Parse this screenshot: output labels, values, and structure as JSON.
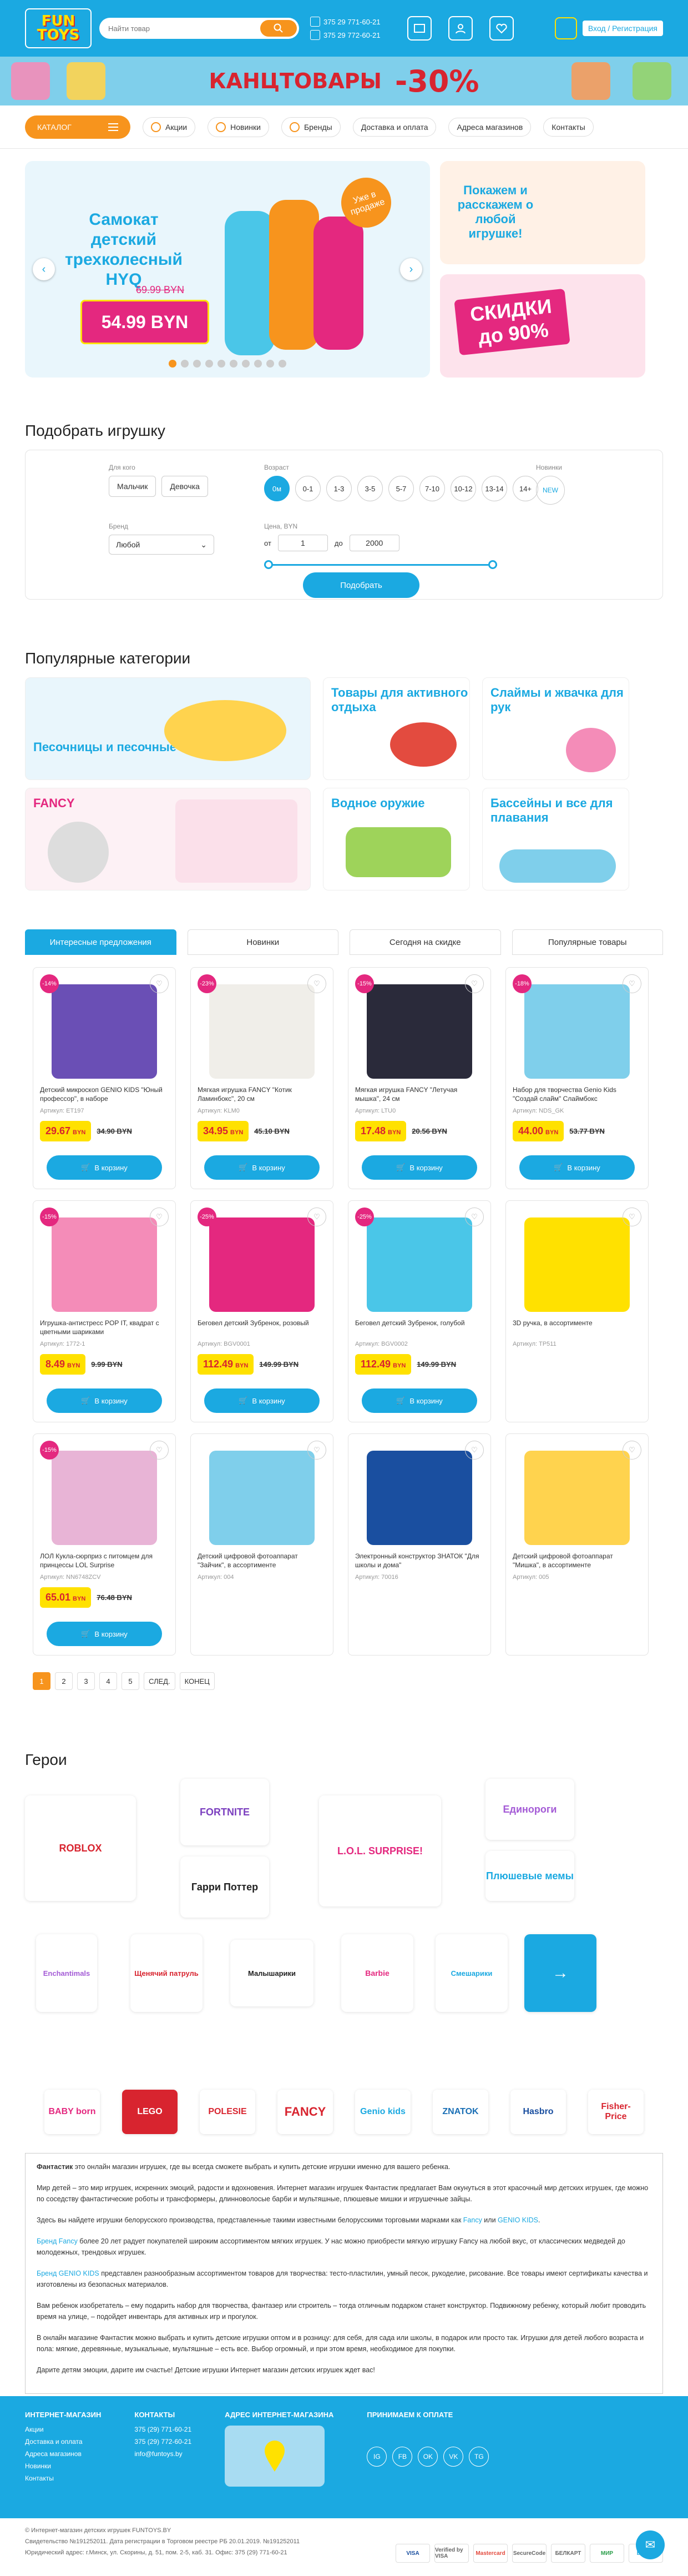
{
  "header": {
    "logo_text": "FUN TOYS",
    "search_placeholder": "Найти товар",
    "phone1": "375 29 771-60-21",
    "phone2": "375 29 772-60-21",
    "login_label": "Вход / Регистрация",
    "accent": "#1ba9e1",
    "icons": [
      "map-icon",
      "user-icon",
      "heart-icon",
      "basket-icon"
    ]
  },
  "promo": {
    "title": "КАНЦТОВАРЫ",
    "discount": "-30%"
  },
  "nav": {
    "catalog": "КАТАЛОГ",
    "items": [
      "Акции",
      "Новинки",
      "Бренды",
      "Доставка и оплата",
      "Адреса магазинов",
      "Контакты"
    ]
  },
  "slider": {
    "title": "Самокат детский трехколесный HYQ",
    "old_price": "69.99 BYN",
    "price": "54.99 BYN",
    "badge": "Уже в продаже",
    "side1": "Покажем и расскажем о любой игрушке!",
    "side2": "СКИДКИ до 90%"
  },
  "filter": {
    "title": "Подобрать игрушку",
    "gender_label": "Для кого",
    "gender": [
      "Мальчик",
      "Девочка"
    ],
    "age_label": "Возраст",
    "ages": [
      "0м",
      "0-1",
      "1-3",
      "3-5",
      "5-7",
      "7-10",
      "10-12",
      "13-14",
      "14+"
    ],
    "novelty_label": "Новинки",
    "novelty": "NEW",
    "brand_label": "Бренд",
    "brand_value": "Любой",
    "price_label": "Цена, BYN",
    "price_from_label": "от",
    "price_from": "1",
    "price_to_label": "до",
    "price_to": "2000",
    "submit": "Подобрать"
  },
  "categories": {
    "title": "Популярные категории",
    "items": [
      "Песочницы и песочные наборы",
      "Товары для активного отдыха",
      "Слаймы и жвачка для рук",
      "FANCY",
      "Водное оружие",
      "Бассейны и все для плавания"
    ]
  },
  "products": {
    "tabs": [
      "Интересные предложения",
      "Новинки",
      "Сегодня на скидке",
      "Популярные товары"
    ],
    "cart_label": "В корзину",
    "items": [
      {
        "disc": "-14%",
        "name": "Детский микроскоп GENIO KIDS \"Юный профессор\", в наборе",
        "art": "Артикул: ET197",
        "price": "29.67",
        "old": "34.90 BYN"
      },
      {
        "disc": "-23%",
        "name": "Мягкая игрушка FANCY \"Котик Ламинбокс\", 20 см",
        "art": "Артикул: KLM0",
        "price": "34.95",
        "old": "45.10 BYN"
      },
      {
        "disc": "-15%",
        "name": "Мягкая игрушка FANCY \"Летучая мышка\", 24 см",
        "art": "Артикул: LTU0",
        "price": "17.48",
        "old": "20.56 BYN"
      },
      {
        "disc": "-18%",
        "name": "Набор для творчества Genio Kids \"Создай слайм\" Слаймбокс",
        "art": "Артикул: NDS_GK",
        "price": "44.00",
        "old": "53.77 BYN"
      },
      {
        "disc": "-15%",
        "name": "Игрушка-антистресс POP IT, квадрат с цветными шариками",
        "art": "Артикул: 1772-1",
        "price": "8.49",
        "old": "9.99 BYN"
      },
      {
        "disc": "-25%",
        "name": "Беговел детский Зубренок, розовый",
        "art": "Артикул: BGV0001",
        "price": "112.49",
        "old": "149.99 BYN"
      },
      {
        "disc": "-25%",
        "name": "Беговел детский Зубренок, голубой",
        "art": "Артикул: BGV0002",
        "price": "112.49",
        "old": "149.99 BYN"
      },
      {
        "disc": "",
        "name": "3D ручка, в ассортименте",
        "art": "Артикул: TP511",
        "price": "",
        "old": ""
      },
      {
        "disc": "-15%",
        "name": "ЛОЛ Кукла-сюрприз с питомцем для принцессы LOL Surprise",
        "art": "Артикул: NN6748ZCV",
        "price": "65.01",
        "old": "76.48 BYN"
      },
      {
        "disc": "",
        "name": "Детский цифровой фотоаппарат \"Зайчик\", в ассортименте",
        "art": "Артикул: 004",
        "price": "",
        "old": ""
      },
      {
        "disc": "",
        "name": "Электронный конструктор ЗНАТОК \"Для школы и дома\"",
        "art": "Артикул: 70016",
        "price": "",
        "old": ""
      },
      {
        "disc": "",
        "name": "Детский цифровой фотоаппарат \"Мишка\", в ассортименте",
        "art": "Артикул: 005",
        "price": "",
        "old": ""
      }
    ],
    "pages": [
      "1",
      "2",
      "3",
      "4",
      "5",
      "СЛЕД.",
      "КОНЕЦ"
    ]
  },
  "heroes": {
    "title": "Герои",
    "items": [
      "ROBLOX",
      "FORTNITE",
      "L.O.L. SURPRISE!",
      "Единороги",
      "Плюшевые мемы",
      "Гарри Поттер",
      "Enchantimals",
      "Щенячий патруль",
      "Малышарики",
      "Barbie",
      "Смешарики"
    ],
    "brands": [
      "BABY born",
      "LEGO",
      "POLESIE",
      "FANCY",
      "Genio kids",
      "ZNATOK",
      "Hasbro",
      "Fisher-Price"
    ]
  },
  "seo": {
    "p1_b": "Фантастик",
    "p1": " это онлайн магазин игрушек, где вы всегда сможете выбрать и купить детские игрушки именно для вашего ребенка.",
    "p2": "Мир детей – это мир игрушек, искренних эмоций, радости и вдохновения. Интернет магазин игрушек Фантастик предлагает Вам окунуться в этот красочный мир детских игрушек, где можно по соседству фантастические роботы и трансформеры, длинноволосые барби и мультяшные, плюшевые мишки и игрушечные зайцы.",
    "p3": "Здесь вы найдете игрушки белорусского производства, представленные такими известными белорусскими торговыми марками как ",
    "p3_a1": "Fancy",
    "p3_mid": " или ",
    "p3_a2": "GENIO KIDS",
    "p3_end": ".",
    "p4_a": "Бренд Fancy",
    "p4": " более 20 лет радует покупателей широким ассортиментом мягких игрушек. У нас можно приобрести мягкую игрушку Fancy на любой вкус, от классических медведей до молодежных, трендовых игрушек.",
    "p5_a": "Бренд GENIO KIDS",
    "p5": " представлен разнообразным ассортиментом товаров для творчества: тесто-пластилин, умный песок, рукоделие, рисование. Все товары имеют сертификаты качества и изготовлены из безопасных материалов.",
    "p6": "Вам ребенок изобретатель – ему подарить набор для творчества, фантазер или строитель – тогда отличным подарком станет конструктор. Подвижному ребенку, который любит проводить время на улице, – подойдет инвентарь для активных игр и прогулок.",
    "p7": "В онлайн магазине Фантастик можно выбрать и купить детские игрушки оптом и в розницу: для себя, для сада или школы, в подарок или просто так. Игрушки для детей любого возраста и пола: мягкие, деревянные, музыкальные, мультяшные – есть все. Выбор огромный, и при этом время, необходимое для покупки.",
    "p8": "Дарите детям эмоции, дарите им счастье! Детские игрушки Интернет магазин детских игрушек ждет вас!"
  },
  "footer": {
    "col1_title": "ИНТЕРНЕТ-МАГАЗИН",
    "col1": [
      "Акции",
      "Доставка и оплата",
      "Адреса магазинов",
      "Новинки",
      "Контакты"
    ],
    "col2_title": "КОНТАКТЫ",
    "phones": [
      "375 (29) 771-60-21",
      "375 (29) 772-60-21",
      "info@funtoys.by"
    ],
    "col3_title": "АДРЕС ИНТЕРНЕТ-МАГАЗИНА",
    "col4_title": "ПРИНИМАЕМ К ОПЛАТЕ",
    "socials": [
      "IG",
      "FB",
      "OK",
      "VK",
      "TG"
    ]
  },
  "bottom": {
    "copy": "© Интернет-магазин детских игрушек FUNTOYS.BY",
    "reg": "Свидетельство №191252011. Дата регистрации в Торговом реестре РБ 20.01.2019. №191252011",
    "addr": "Юридический адрес: г.Минск, ул. Скорины, д. 51, пом. 2-5, каб. 31. Офис: 375 (29) 771-60-21",
    "pays": [
      "VISA",
      "Verified by VISA",
      "Mastercard",
      "SecureCode",
      "БЕЛКАРТ",
      "МИР",
      "bePaid"
    ]
  }
}
